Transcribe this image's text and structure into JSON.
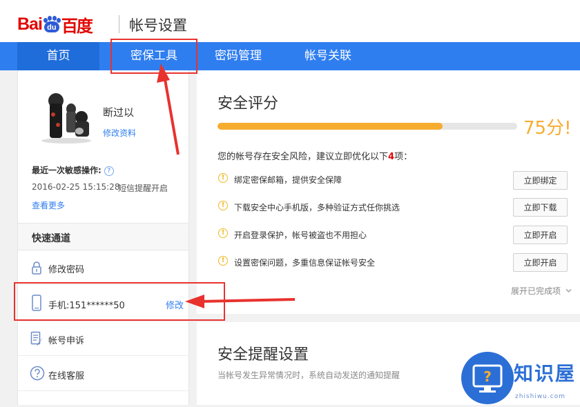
{
  "header": {
    "logo_bai": "Bai",
    "logo_du": "du",
    "logo_cn": "百度",
    "site_title": "帐号设置"
  },
  "nav": {
    "items": [
      {
        "label": "首页"
      },
      {
        "label": "密保工具"
      },
      {
        "label": "密码管理"
      },
      {
        "label": "帐号关联"
      }
    ]
  },
  "profile": {
    "username": "断过以",
    "edit_link": "修改资料",
    "recent_title": "最近一次敏感操作:",
    "help_icon": "?",
    "recent_time": "2016-02-25 15:15:28",
    "recent_action": "短信提醒开启",
    "view_more": "查看更多"
  },
  "quick": {
    "title": "快速通道",
    "items": [
      {
        "label": "修改密码",
        "icon": "lock-icon"
      },
      {
        "label": "手机:151******50",
        "action": "修改",
        "icon": "phone-icon"
      },
      {
        "label": "帐号申诉",
        "icon": "appeal-icon"
      },
      {
        "label": "在线客服",
        "icon": "help-circle-icon"
      }
    ]
  },
  "security": {
    "title": "安全评分",
    "score": "75分!",
    "score_value": 75,
    "risk_prefix": "您的帐号存在安全风险，建议立即优化以下",
    "risk_count": "4",
    "risk_suffix": "项：",
    "tasks": [
      {
        "label": "绑定密保邮箱，提供安全保障",
        "button": "立即绑定"
      },
      {
        "label": "下载安全中心手机版，多种验证方式任你挑选",
        "button": "立即下载"
      },
      {
        "label": "开启登录保护，帐号被盗也不用担心",
        "button": "立即开启"
      },
      {
        "label": "设置密保问题，多重信息保证帐号安全",
        "button": "立即开启"
      }
    ],
    "expand": "展开已完成项"
  },
  "reminder": {
    "title": "安全提醒设置",
    "desc": "当帐号发生异常情况时，系统自动发送的通知提醒"
  },
  "watermark": {
    "text": "知识屋",
    "url": "zhishiwu.com"
  },
  "colors": {
    "nav_bg": "#2f7ef0",
    "brand_red": "#e10601",
    "score_orange": "#f6ad2f",
    "annotation_red": "#e8322e"
  }
}
